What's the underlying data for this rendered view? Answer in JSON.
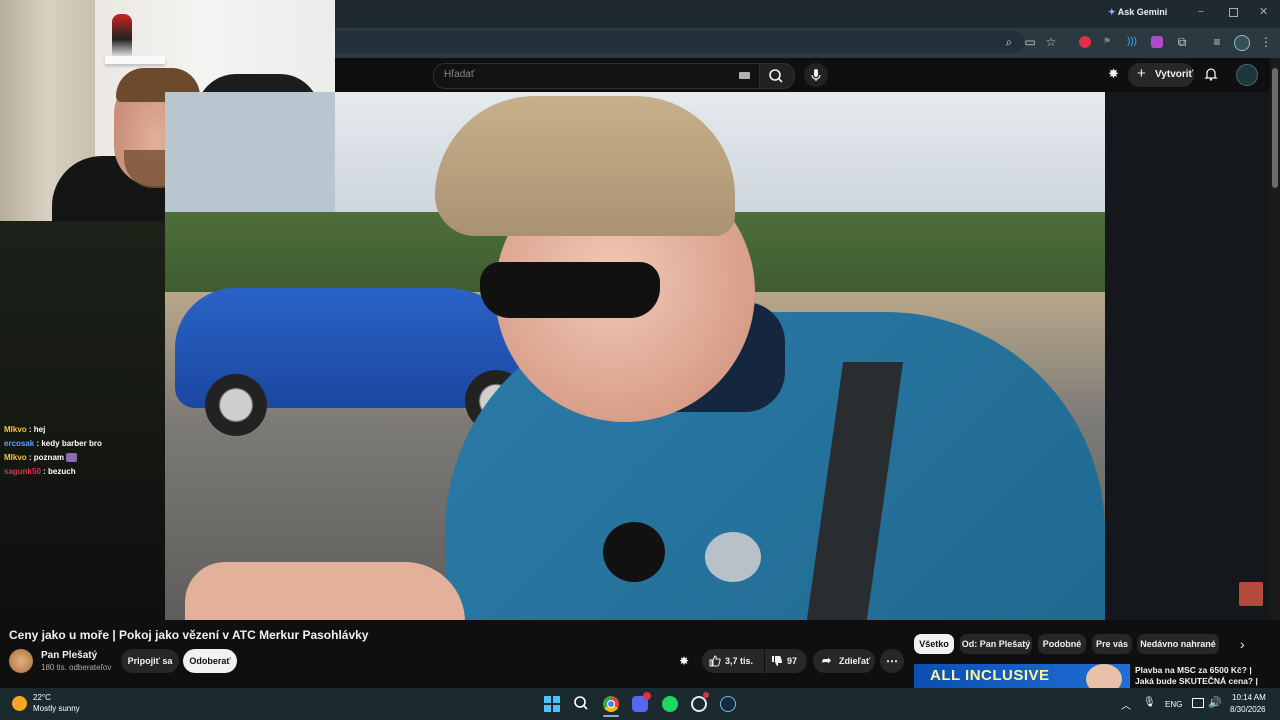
{
  "browser": {
    "ask_gemini": "Ask Gemini"
  },
  "youtube": {
    "search_placeholder": "Hľadať",
    "create_label": "Vytvoriť"
  },
  "chat": [
    {
      "user": "Mlkvo",
      "text": "hej",
      "color": "#f5c542"
    },
    {
      "user": "ercosak",
      "text": "kedy barber bro",
      "color": "#5aa0ff"
    },
    {
      "user": "Mlkvo",
      "text": "poznam",
      "color": "#f5c542"
    },
    {
      "user": "sagunk50",
      "text": "bezuch",
      "color": "#e0304a"
    }
  ],
  "video": {
    "title": "Ceny jako u moře | Pokoj jako vězení v ATC Merkur Pasohlávky",
    "channel_name": "Pan Plešatý",
    "subscribers": "180 tis. odberateľov",
    "join_label": "Pripojiť sa",
    "subscribe_label": "Odoberať",
    "likes": "3,7 tis.",
    "dislikes": "97",
    "share_label": "Zdieľať"
  },
  "filters": [
    "Všetko",
    "Od: Pan Plešatý",
    "Podobné",
    "Pre vás",
    "Nedávno nahrané"
  ],
  "recommended": {
    "thumb_text": "ALL INCLUSIVE",
    "title": "Plavba na MSC za 6500 Kč? | Jaká bude SKUTEČNÁ cena? |"
  },
  "taskbar": {
    "temperature": "22°C",
    "weather": "Mostly sunny",
    "language": "ENG",
    "time": "10:14 AM",
    "date": "8/30/2026"
  },
  "colors": {
    "accent": "#3ea6ff",
    "subscribe_bg": "#f1f1f1",
    "taskbar_bg": "#1b2a2e"
  },
  "icons": [
    "search-icon",
    "mic-icon",
    "bell-icon",
    "like-icon",
    "dislike-icon",
    "share-icon",
    "more-icon",
    "chevron-right-icon",
    "windows-start-icon",
    "chrome-icon",
    "discord-icon",
    "spotify-icon",
    "steam-icon"
  ]
}
